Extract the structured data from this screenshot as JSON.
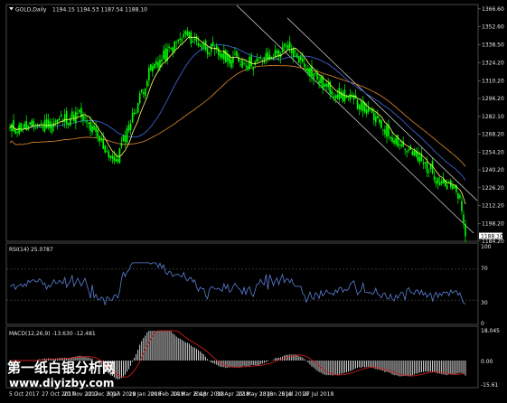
{
  "header": {
    "symbol": "GOLD,Daily",
    "ohlc": "1194.15 1194.53 1187.54 1188.10"
  },
  "rsi": {
    "label": "RSI(14) 25.0787",
    "levels": [
      "100",
      "70",
      "30",
      "0"
    ]
  },
  "macd": {
    "label": "MACD(12,26,9) -13.630 -12.481",
    "levels": [
      "18.045",
      "0.00",
      "-15.61"
    ]
  },
  "watermark": {
    "text": "第一纸白银分析网",
    "url": "www.diyizby.com"
  },
  "colors": {
    "background": "#000000",
    "bull": "#00ff00",
    "fast_ma": "#ffff66",
    "mid_ma": "#3f5fcf",
    "slow_ma": "#c87a2a",
    "rsi": "#5b7fd6",
    "macd_signal": "#c81e1e",
    "macd_hist": "#e6e6e6",
    "channel": "#e0e0e0"
  },
  "chart_data": [
    {
      "type": "candlestick",
      "title": "GOLD,Daily",
      "y_ticks": [
        "1366.60",
        "1352.60",
        "1338.50",
        "1324.20",
        "1310.20",
        "1296.20",
        "1282.10",
        "1268.20",
        "1254.20",
        "1240.20",
        "1226.20",
        "1212.20",
        "1198.20",
        "1188.10",
        "1184.20"
      ],
      "ylim": [
        1184.2,
        1370
      ],
      "x_ticks": [
        "5 Oct 2017",
        "27 Oct 2017",
        "20 Nov 2017",
        "12 Dec 2017",
        "5 Jan 2018",
        "29 Jan 2018",
        "20 Feb 2018",
        "14 Mar 2018",
        "6 Apr 2018",
        "30 Apr 2018",
        "22 May 2018",
        "13 Jun 2018",
        "5 Jul 2018",
        "27 Jul 2018"
      ],
      "close_path": [
        {
          "x": "5 Oct 2017",
          "y": 1272
        },
        {
          "x": "27 Oct 2017",
          "y": 1276
        },
        {
          "x": "20 Nov 2017",
          "y": 1284
        },
        {
          "x": "12 Dec 2017",
          "y": 1246
        },
        {
          "x": "5 Jan 2018",
          "y": 1318
        },
        {
          "x": "29 Jan 2018",
          "y": 1346
        },
        {
          "x": "20 Feb 2018",
          "y": 1330
        },
        {
          "x": "14 Mar 2018",
          "y": 1324
        },
        {
          "x": "6 Apr 2018",
          "y": 1336
        },
        {
          "x": "30 Apr 2018",
          "y": 1305
        },
        {
          "x": "22 May 2018",
          "y": 1292
        },
        {
          "x": "13 Jun 2018",
          "y": 1264
        },
        {
          "x": "5 Jul 2018",
          "y": 1240
        },
        {
          "x": "27 Jul 2018",
          "y": 1220
        },
        {
          "x": "27 Jul 2018",
          "y": 1188.1
        }
      ]
    },
    {
      "type": "line",
      "title": "RSI(14) 25.0787",
      "ylim": [
        0,
        100
      ],
      "levels": [
        70,
        30
      ]
    },
    {
      "type": "bar",
      "title": "MACD(12,26,9) -13.630 -12.481",
      "ylim": [
        -15.61,
        18.045
      ]
    }
  ]
}
